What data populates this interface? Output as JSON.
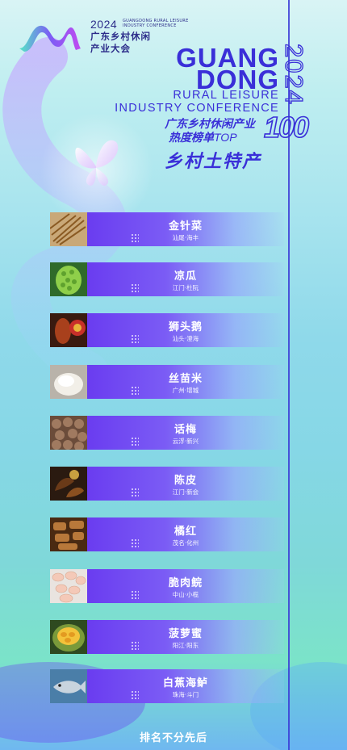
{
  "header": {
    "logo_year": "2024",
    "logo_en_line1": "GUANGDONG RURAL LEISURE",
    "logo_en_line2": "INDUSTRY CONFERENCE",
    "logo_cn_line1": "广东乡村休闲",
    "logo_cn_line2": "产业大会"
  },
  "title": {
    "guang": "GUANG",
    "dong": "DONG",
    "sub1": "RURAL LEISURE",
    "sub2": "INDUSTRY CONFERENCE",
    "year": "2024",
    "rank_line1": "广东乡村休闲产业",
    "rank_line2_cn": "热度榜单",
    "rank_line2_top": "TOP",
    "rank_100": "100",
    "category": "乡村土特产"
  },
  "items": [
    {
      "name": "金针菜",
      "place": "汕尾·海丰",
      "thumb": "daylily"
    },
    {
      "name": "凉瓜",
      "place": "江门·杜阮",
      "thumb": "bitter-melon"
    },
    {
      "name": "狮头鹅",
      "place": "汕头·澄海",
      "thumb": "goose"
    },
    {
      "name": "丝苗米",
      "place": "广州·增城",
      "thumb": "rice"
    },
    {
      "name": "话梅",
      "place": "云浮·新兴",
      "thumb": "plum"
    },
    {
      "name": "陈皮",
      "place": "江门·新会",
      "thumb": "peel"
    },
    {
      "name": "橘红",
      "place": "茂名·化州",
      "thumb": "pomelo-peel"
    },
    {
      "name": "脆肉鲩",
      "place": "中山·小榄",
      "thumb": "fish-slices"
    },
    {
      "name": "菠萝蜜",
      "place": "阳江·阳东",
      "thumb": "jackfruit"
    },
    {
      "name": "白蕉海鲈",
      "place": "珠海·斗门",
      "thumb": "seabass"
    }
  ],
  "footer": {
    "note": "排名不分先后"
  },
  "colors": {
    "accent": "#3a2fd8",
    "card": "#6a3cf0"
  }
}
